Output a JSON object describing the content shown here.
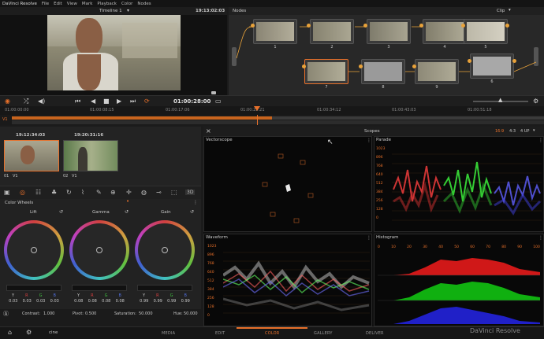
{
  "menu": {
    "items": [
      "DaVinci Resolve",
      "File",
      "Edit",
      "View",
      "Mark",
      "Playback",
      "Color",
      "Nodes"
    ]
  },
  "viewer": {
    "timeline_label": "Timeline 1",
    "timecode": "19:13:02:03"
  },
  "nodes": {
    "title": "Nodes",
    "mode": "Clip",
    "labels": [
      "1",
      "2",
      "3",
      "4",
      "5",
      "6",
      "7",
      "8",
      "9"
    ]
  },
  "transport": {
    "timecode": "01:00:28:00"
  },
  "ruler": {
    "ticks": [
      "01:00:00:00",
      "01:00:08:15",
      "01:00:17:06",
      "01:00:25:21",
      "01:00:34:12",
      "01:00:43:03",
      "01:00:51:18"
    ]
  },
  "track": {
    "label": "V1"
  },
  "clips": [
    {
      "timecode": "19:12:34:03",
      "label": "01",
      "track": "V1"
    },
    {
      "timecode": "19:20:31:16",
      "label": "02",
      "track": "V1"
    }
  ],
  "color_wheels": {
    "title": "Color Wheels",
    "wheels": [
      {
        "name": "Lift",
        "y": "0.03",
        "r": "0.03",
        "g": "0.03",
        "b": "0.03"
      },
      {
        "name": "Gamma",
        "y": "0.08",
        "r": "0.08",
        "g": "0.08",
        "b": "0.08"
      },
      {
        "name": "Gain",
        "y": "0.99",
        "r": "0.99",
        "g": "0.99",
        "b": "0.99"
      }
    ],
    "channel_labels": [
      "Y",
      "R",
      "G",
      "B"
    ],
    "contrast_label": "Contrast:",
    "contrast": "1.000",
    "pivot_label": "Pivot:",
    "pivot": "0.500",
    "saturation_label": "Saturation:",
    "saturation": "50.000",
    "hue_label": "Hue:",
    "hue": "50.000"
  },
  "scopes": {
    "title": "Scopes",
    "aspect_options": [
      "16:9",
      "4:3"
    ],
    "layout": "4 UP",
    "panels": [
      "Vectorscope",
      "Parade",
      "Waveform",
      "Histogram"
    ],
    "scale": [
      "1023",
      "896",
      "768",
      "640",
      "512",
      "384",
      "256",
      "128",
      "0"
    ],
    "histogram_ticks": [
      "0",
      "10",
      "20",
      "30",
      "40",
      "50",
      "60",
      "70",
      "80",
      "90",
      "100"
    ]
  },
  "pages": {
    "tabs": [
      "MEDIA",
      "EDIT",
      "COLOR",
      "GALLERY",
      "DELIVER"
    ],
    "active": "COLOR",
    "brand": "DaVinci Resolve",
    "user_label": "cine"
  }
}
